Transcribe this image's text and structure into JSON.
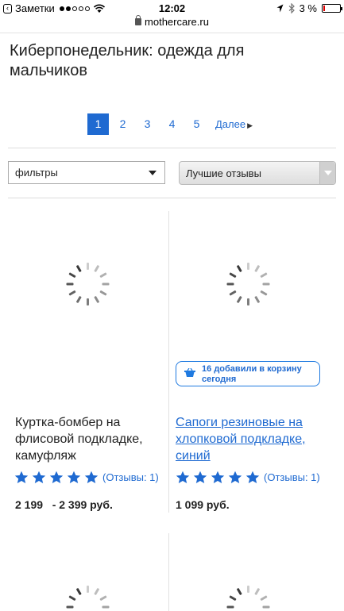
{
  "status_bar": {
    "back_app": "Заметки",
    "time": "12:02",
    "battery": "3 %"
  },
  "url": "mothercare.ru",
  "page_title": "Киберпонедельник: одежда для мальчиков",
  "pagination": {
    "pages": [
      "1",
      "2",
      "3",
      "4",
      "5"
    ],
    "active": "1",
    "next_label": "Далее"
  },
  "filters_label": "фильтры",
  "sort_selected": "Лучшие отзывы",
  "products": [
    {
      "name": "Куртка-бомбер на флисовой подкладке, камуфляж",
      "rating": 5,
      "reviews": "(Отзывы: 1)",
      "price": "2 199   - 2 399 руб."
    },
    {
      "name": "Сапоги резиновые на хлопковой подкладке, синий",
      "rating": 5,
      "reviews": "(Отзывы: 1)",
      "price": "1 099 руб.",
      "cart_count": "16",
      "cart_text": "добавили в корзину сегодня"
    }
  ],
  "colors": {
    "accent": "#1f6ad1"
  }
}
